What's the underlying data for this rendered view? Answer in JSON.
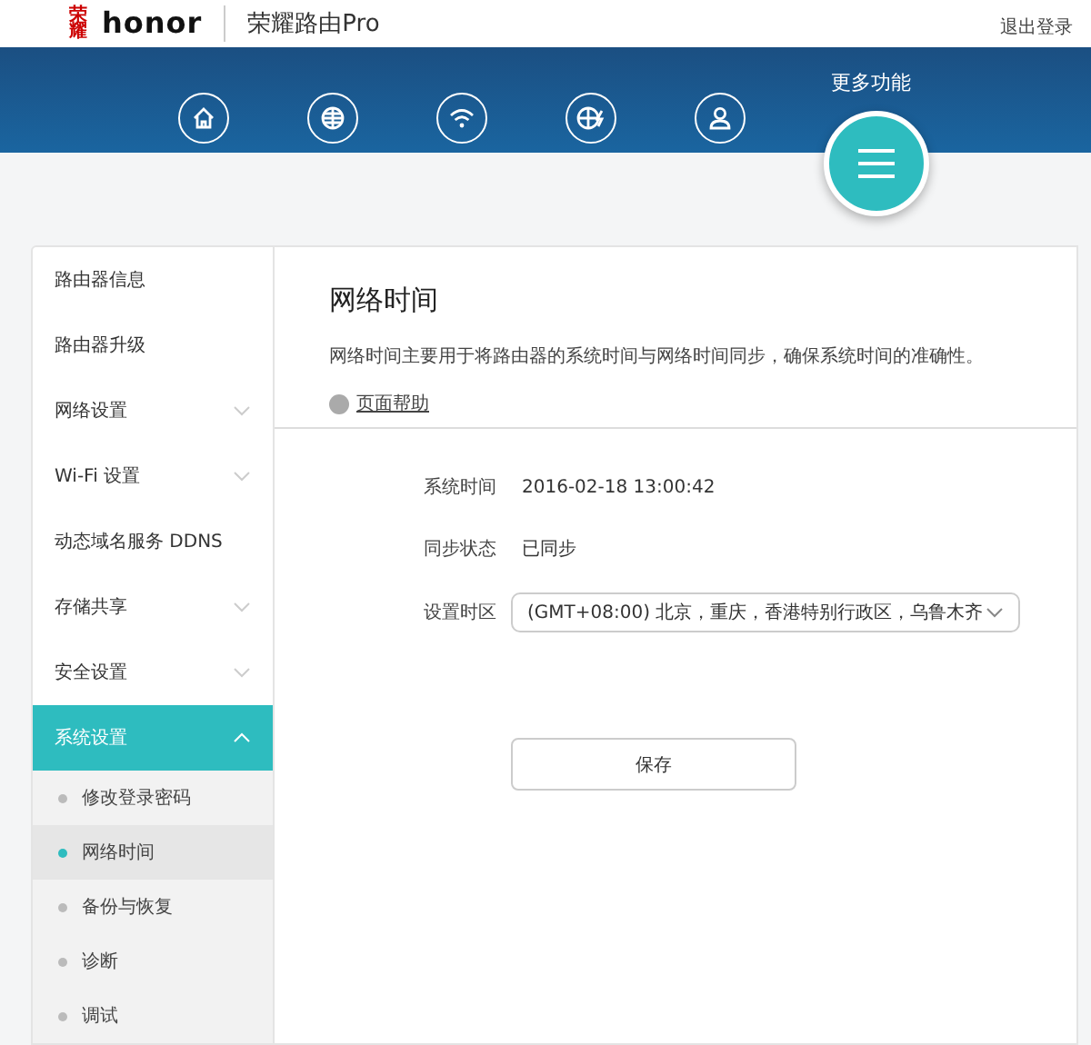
{
  "header": {
    "logo_small": "荣耀",
    "logo": "honor",
    "product": "荣耀路由Pro",
    "logout": "退出登录"
  },
  "nav": {
    "icons": [
      {
        "kind": "home"
      },
      {
        "kind": "globe"
      },
      {
        "kind": "wifi"
      },
      {
        "kind": "globe-bolt"
      },
      {
        "kind": "user"
      }
    ],
    "more": {
      "label": "更多功能",
      "selected": true
    }
  },
  "sidebar": {
    "items": [
      {
        "label": "路由器信息",
        "kind": "plain",
        "selected": false
      },
      {
        "label": "路由器升级",
        "kind": "plain",
        "selected": false
      },
      {
        "label": "网络设置",
        "kind": "collapsed",
        "selected": false
      },
      {
        "label": "Wi-Fi 设置",
        "kind": "collapsed",
        "selected": false
      },
      {
        "label": "动态域名服务 DDNS",
        "kind": "plain",
        "selected": false
      },
      {
        "label": "存储共享",
        "kind": "collapsed",
        "selected": false
      },
      {
        "label": "安全设置",
        "kind": "collapsed",
        "selected": false
      },
      {
        "label": "系统设置",
        "kind": "expanded",
        "selected": true,
        "children": [
          {
            "label": "修改登录密码",
            "selected": false
          },
          {
            "label": "网络时间",
            "selected": true
          },
          {
            "label": "备份与恢复",
            "selected": false
          },
          {
            "label": "诊断",
            "selected": false
          },
          {
            "label": "调试",
            "selected": false
          }
        ]
      }
    ]
  },
  "main": {
    "title": "网络时间",
    "description": "网络时间主要用于将路由器的系统时间与网络时间同步，确保系统时间的准确性。",
    "help": "页面帮助",
    "fields": [
      {
        "label": "系统时间",
        "kind": "text",
        "value": "2016-02-18 13:00:42"
      },
      {
        "label": "同步状态",
        "kind": "text",
        "value": "已同步"
      },
      {
        "label": "设置时区",
        "kind": "select",
        "value": "(GMT+08:00) 北京，重庆，香港特别行政区，乌鲁木齐"
      }
    ],
    "save": "保存"
  }
}
